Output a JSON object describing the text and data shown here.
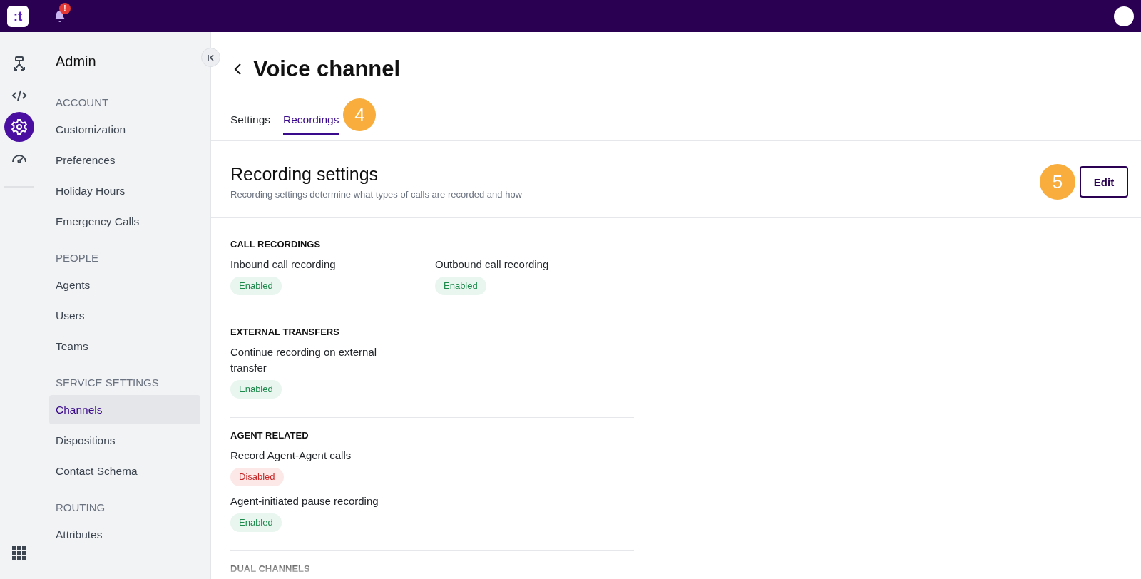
{
  "topbar": {
    "logo": ":t",
    "notification_badge": "!"
  },
  "rail": [
    {
      "selected": false
    },
    {
      "selected": false
    },
    {
      "selected": true
    },
    {
      "selected": false
    }
  ],
  "sidebar": {
    "title": "Admin",
    "groups": [
      {
        "heading": "ACCOUNT",
        "items": [
          {
            "label": "Customization",
            "selected": false
          },
          {
            "label": "Preferences",
            "selected": false
          },
          {
            "label": "Holiday Hours",
            "selected": false
          },
          {
            "label": "Emergency Calls",
            "selected": false
          }
        ]
      },
      {
        "heading": "PEOPLE",
        "items": [
          {
            "label": "Agents",
            "selected": false
          },
          {
            "label": "Users",
            "selected": false
          },
          {
            "label": "Teams",
            "selected": false
          }
        ]
      },
      {
        "heading": "SERVICE SETTINGS",
        "items": [
          {
            "label": "Channels",
            "selected": true
          },
          {
            "label": "Dispositions",
            "selected": false
          },
          {
            "label": "Contact Schema",
            "selected": false
          }
        ]
      },
      {
        "heading": "ROUTING",
        "items": [
          {
            "label": "Attributes",
            "selected": false
          }
        ]
      }
    ]
  },
  "page": {
    "title": "Voice channel",
    "tabs": [
      {
        "label": "Settings",
        "selected": false
      },
      {
        "label": "Recordings",
        "selected": true
      }
    ],
    "tab_step": "4",
    "header": {
      "title": "Recording settings",
      "subtitle": "Recording settings determine what types of calls are recorded and how",
      "edit_step": "5",
      "edit_button": "Edit"
    },
    "sections": [
      {
        "title": "CALL RECORDINGS",
        "rows": [
          [
            {
              "label": "Inbound call recording",
              "enabled": true,
              "status_text": "Enabled"
            },
            {
              "label": "Outbound call recording",
              "enabled": true,
              "status_text": "Enabled"
            }
          ]
        ]
      },
      {
        "title": "EXTERNAL TRANSFERS",
        "rows": [
          [
            {
              "label": "Continue recording on external transfer",
              "enabled": true,
              "status_text": "Enabled"
            }
          ]
        ]
      },
      {
        "title": "AGENT RELATED",
        "rows": [
          [
            {
              "label": "Record Agent-Agent calls",
              "enabled": false,
              "status_text": "Disabled"
            }
          ],
          [
            {
              "label": "Agent-initiated pause recording",
              "enabled": true,
              "status_text": "Enabled"
            }
          ]
        ]
      },
      {
        "title": "DUAL CHANNELS"
      }
    ]
  }
}
